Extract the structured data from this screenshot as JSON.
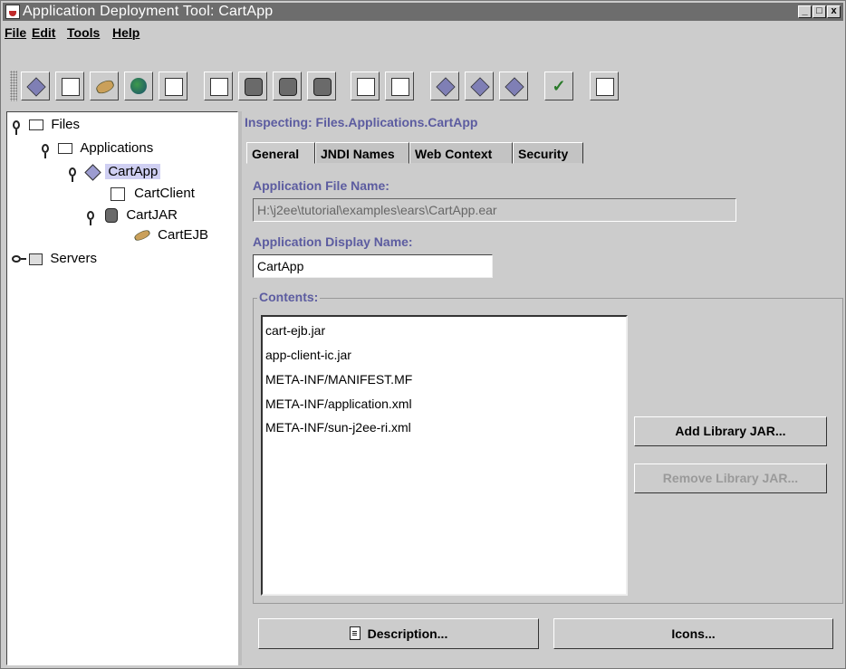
{
  "window": {
    "title": "Application Deployment Tool: CartApp",
    "controls": [
      "_",
      "□",
      "x"
    ]
  },
  "menu": [
    "File",
    "Edit",
    "Tools",
    "Help"
  ],
  "toolbar": {
    "icons": [
      "new-application-icon",
      "new-app-client-icon",
      "new-enterprise-bean-icon",
      "new-web-component-icon",
      "new-connector-icon",
      "add-app-client-icon",
      "add-ejb-jar-icon",
      "add-web-war-icon",
      "add-connector-rar-icon",
      "open-icon",
      "save-icon",
      "deploy-icon",
      "update-deploy-icon",
      "update-files-icon",
      "verify-icon",
      "descriptor-viewer-icon"
    ]
  },
  "tree": {
    "files": "Files",
    "applications": "Applications",
    "cartapp": "CartApp",
    "cartclient": "CartClient",
    "cartjar": "CartJAR",
    "cartejb": "CartEJB",
    "servers": "Servers"
  },
  "inspector": {
    "heading": "Inspecting: Files.Applications.CartApp",
    "tabs": [
      "General",
      "JNDI Names",
      "Web Context",
      "Security"
    ],
    "file_label": "Application File Name:",
    "file_value": "H:\\j2ee\\tutorial\\examples\\ears\\CartApp.ear",
    "display_label": "Application Display Name:",
    "display_value": "CartApp",
    "contents_label": "Contents:",
    "contents": [
      "cart-ejb.jar",
      "app-client-ic.jar",
      "META-INF/MANIFEST.MF",
      "META-INF/application.xml",
      "META-INF/sun-j2ee-ri.xml"
    ],
    "add_button": "Add Library JAR...",
    "remove_button": "Remove Library JAR...",
    "description_button": "Description...",
    "icons_button": "Icons..."
  }
}
